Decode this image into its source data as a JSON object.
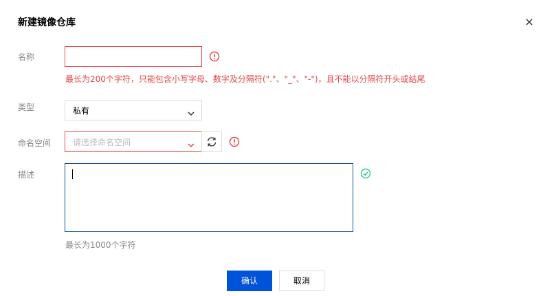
{
  "dialog": {
    "title": "新建镜像仓库",
    "close_icon": "close-icon"
  },
  "form": {
    "name": {
      "label": "名称",
      "value": "",
      "error": "最长为200个字符，只能包含小写字母、数字及分隔符(\".\"、\"_\"、\"-\")，且不能以分隔符开头或结尾",
      "status_icon": "error-circle-icon"
    },
    "type": {
      "label": "类型",
      "value": "私有"
    },
    "namespace": {
      "label": "命名空间",
      "placeholder": "请选择命名空间",
      "refresh_icon": "refresh-icon",
      "status_icon": "error-circle-icon"
    },
    "description": {
      "label": "描述",
      "value": "",
      "hint": "最长为1000个字符",
      "status_icon": "check-circle-icon"
    }
  },
  "buttons": {
    "confirm": "确认",
    "cancel": "取消"
  },
  "colors": {
    "error": "#e54545",
    "success": "#29cc85",
    "primary": "#0052d9",
    "input_focus": "#0e4e8f"
  }
}
